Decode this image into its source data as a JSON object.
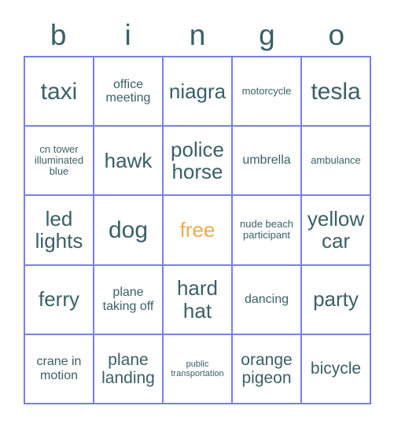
{
  "card": {
    "title": "bingo",
    "header_letters": [
      "b",
      "i",
      "n",
      "g",
      "o"
    ],
    "text_color": "#3a6067",
    "grid_color": "#787fe8",
    "free_color": "#efa94d",
    "rows": 5,
    "columns": 5,
    "cells": [
      [
        {
          "label": "taxi",
          "size": "fs-xl",
          "free": false
        },
        {
          "label": "office meeting",
          "size": "fs-sm",
          "free": false
        },
        {
          "label": "niagra",
          "size": "fs-lg",
          "free": false
        },
        {
          "label": "motorcycle",
          "size": "fs-xs",
          "free": false
        },
        {
          "label": "tesla",
          "size": "fs-xl",
          "free": false
        }
      ],
      [
        {
          "label": "cn tower illuminated blue",
          "size": "fs-xs",
          "free": false
        },
        {
          "label": "hawk",
          "size": "fs-lg",
          "free": false
        },
        {
          "label": "police horse",
          "size": "fs-lg",
          "free": false
        },
        {
          "label": "umbrella",
          "size": "fs-sm",
          "free": false
        },
        {
          "label": "ambulance",
          "size": "fs-xs",
          "free": false
        }
      ],
      [
        {
          "label": "led lights",
          "size": "fs-lg",
          "free": false
        },
        {
          "label": "dog",
          "size": "fs-xl",
          "free": false
        },
        {
          "label": "free",
          "size": "fs-lg",
          "free": true
        },
        {
          "label": "nude beach participant",
          "size": "fs-xs",
          "free": false
        },
        {
          "label": "yellow car",
          "size": "fs-lg",
          "free": false
        }
      ],
      [
        {
          "label": "ferry",
          "size": "fs-lg",
          "free": false
        },
        {
          "label": "plane taking off",
          "size": "fs-sm",
          "free": false
        },
        {
          "label": "hard hat",
          "size": "fs-lg",
          "free": false
        },
        {
          "label": "dancing",
          "size": "fs-sm",
          "free": false
        },
        {
          "label": "party",
          "size": "fs-lg",
          "free": false
        }
      ],
      [
        {
          "label": "crane in motion",
          "size": "fs-sm",
          "free": false
        },
        {
          "label": "plane landing",
          "size": "fs-md",
          "free": false
        },
        {
          "label": "public transportation",
          "size": "fs-xxs",
          "free": false
        },
        {
          "label": "orange pigeon",
          "size": "fs-md",
          "free": false
        },
        {
          "label": "bicycle",
          "size": "fs-md",
          "free": false
        }
      ]
    ]
  }
}
